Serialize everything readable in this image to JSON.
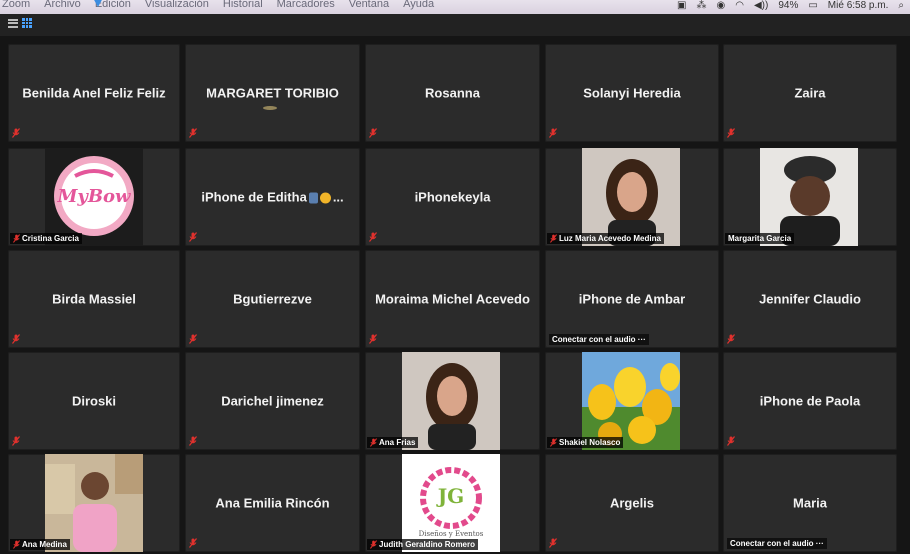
{
  "menubar": {
    "items": [
      "Zoom",
      "Archivo",
      "Edición",
      "Visualización",
      "Historial",
      "Marcadores",
      "Ventana",
      "Ayuda"
    ],
    "battery": "94%",
    "clock": "Mié 6:58 p.m."
  },
  "toolbar": {
    "speaker_view_icon": "bars-icon",
    "gallery_view_icon": "grid-icon",
    "accent": "#4aa3ff"
  },
  "colors": {
    "tile_bg": "#2b2b2b",
    "mute_red": "#e0312d",
    "page_bg": "#151515"
  },
  "participants": [
    {
      "name": "Benilda Anel Feliz Feliz",
      "type": "name",
      "muted": true
    },
    {
      "name": "MARGARET TORIBIO",
      "type": "name",
      "muted": true
    },
    {
      "name": "Rosanna",
      "type": "name",
      "muted": true
    },
    {
      "name": "Solanyi Heredia",
      "type": "name",
      "muted": true
    },
    {
      "name": "Zaira",
      "type": "name",
      "muted": true
    },
    {
      "name": "Cristina Garcia",
      "type": "logo-mybow",
      "logo_text": "MyBow",
      "muted": true
    },
    {
      "name": "iPhone de Editha",
      "suffix": "...",
      "type": "name-emoji",
      "muted": true
    },
    {
      "name": "iPhonekeyla",
      "type": "name",
      "muted": true
    },
    {
      "name": "Luz Maria Acevedo Medina",
      "type": "photo",
      "photo": "woman-photo",
      "muted": true
    },
    {
      "name": "Margarita Garcia",
      "type": "photo",
      "photo": "woman-cap-photo",
      "muted": false
    },
    {
      "name": "Birda Massiel",
      "type": "name",
      "muted": true
    },
    {
      "name": "Bgutierrezve",
      "type": "name",
      "muted": true
    },
    {
      "name": "Moraima Michel Acevedo",
      "type": "name",
      "muted": true
    },
    {
      "name": "iPhone de Ambar",
      "type": "name",
      "muted": false,
      "audio_note": "Conectar con el audio ···"
    },
    {
      "name": "Jennifer Claudio",
      "type": "name",
      "muted": true
    },
    {
      "name": "Diroski",
      "type": "name",
      "muted": true
    },
    {
      "name": "Darichel jimenez",
      "type": "name",
      "muted": true
    },
    {
      "name": "Ana Frias",
      "type": "photo",
      "photo": "woman-photo",
      "muted": true
    },
    {
      "name": "Shakiel Nolasco",
      "type": "photo",
      "photo": "tulips-photo",
      "muted": true
    },
    {
      "name": "iPhone de Paola",
      "type": "name",
      "muted": true
    },
    {
      "name": "Ana Medina",
      "type": "photo",
      "photo": "nurse-photo",
      "muted": true
    },
    {
      "name": "Ana Emilia Rincón",
      "type": "name",
      "muted": true
    },
    {
      "name": "Judith Geraldino Romero",
      "type": "logo-jg",
      "logo_text": "JG",
      "logo_subtext": "Diseños y Eventos",
      "muted": true
    },
    {
      "name": "Argelis",
      "type": "name",
      "muted": true
    },
    {
      "name": "Maria",
      "type": "name",
      "muted": false,
      "audio_note": "Conectar con el audio ···"
    }
  ]
}
